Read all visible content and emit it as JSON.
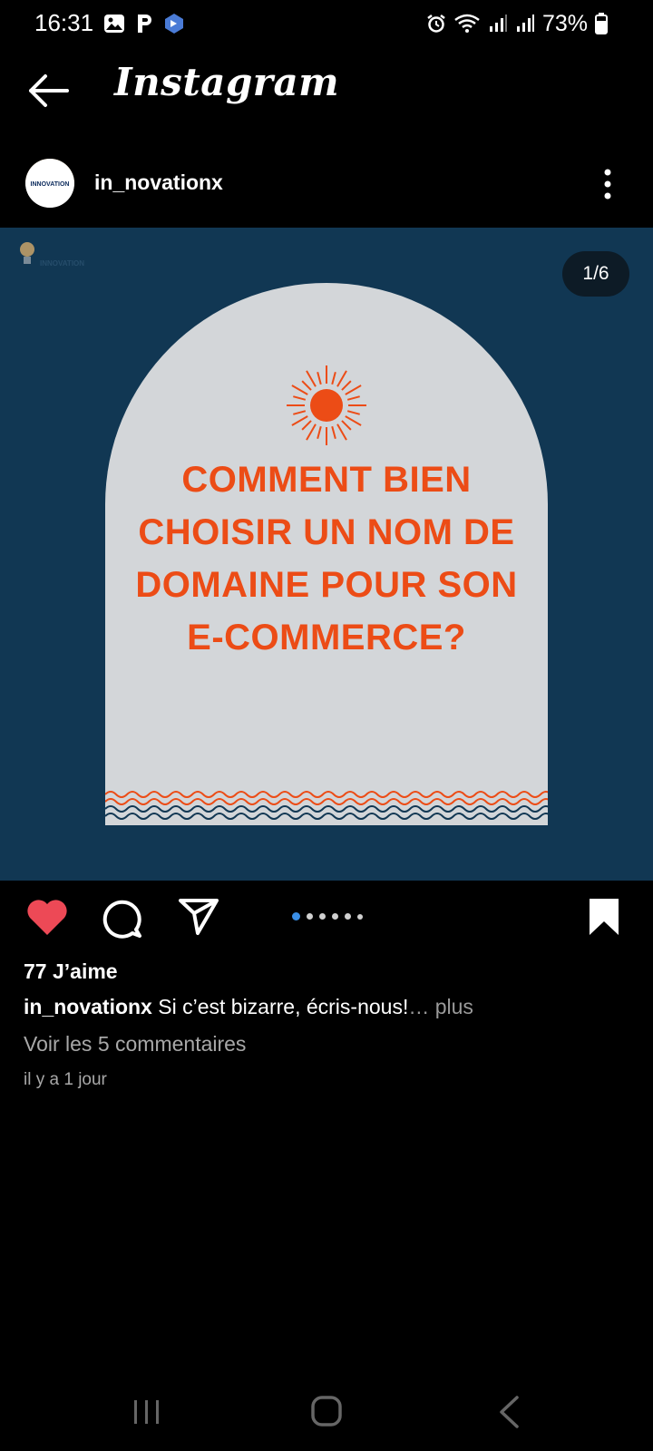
{
  "status_bar": {
    "time": "16:31",
    "battery": "73%",
    "left_icons": [
      "gallery-icon",
      "p-app-icon",
      "shield-app-icon"
    ],
    "right_icons": [
      "alarm-icon",
      "wifi-icon",
      "signal-icon",
      "signal-icon",
      "battery-icon"
    ]
  },
  "header": {
    "app_title": "Instagram"
  },
  "post": {
    "username": "in_novationx",
    "avatar_text": "INNOVATION",
    "watermark": "INNOVATION",
    "slide_counter": "1/6",
    "slide_index": 1,
    "slide_total": 6,
    "headline_lines": [
      "COMMENT BIEN",
      "CHOISIR UN NOM DE",
      "DOMAINE POUR SON",
      "E-COMMERCE?"
    ],
    "colors": {
      "background": "#113753",
      "arch": "#d3d6d9",
      "accent": "#ec4c16",
      "like": "#ed4956",
      "active_dot": "#3a8ee6"
    }
  },
  "engagement": {
    "likes": "77 J’aime",
    "caption_user": "in_novationx",
    "caption_text": " Si c’est bizarre, écris-nous!",
    "caption_more": "… plus",
    "comments_link": "Voir les 5 commentaires",
    "time_ago": "il y a 1 jour"
  },
  "nav_bar": {
    "items": [
      "recents-icon",
      "home-icon",
      "back-icon"
    ]
  }
}
